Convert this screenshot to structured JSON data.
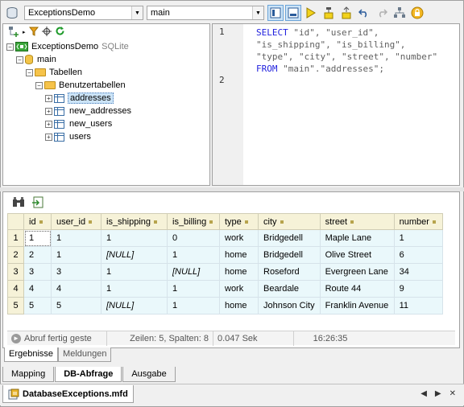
{
  "toolbar": {
    "connection": "ExceptionsDemo",
    "schema": "main"
  },
  "tree": {
    "root": "ExceptionsDemo",
    "root_type": "SQLite",
    "schema": "main",
    "folder": "Tabellen",
    "subfolder": "Benutzertabellen",
    "tables": [
      "addresses",
      "new_addresses",
      "new_users",
      "users"
    ]
  },
  "sql": {
    "line1": "1",
    "line2": "2",
    "kw_select": "SELECT",
    "row1": " \"id\", \"user_id\",",
    "row2": "\"is_shipping\", \"is_billing\",",
    "row3": "\"type\", \"city\", \"street\", \"number\"",
    "kw_from": "FROM",
    "row4_rest": " \"main\".\"addresses\";"
  },
  "results": {
    "columns": [
      "id",
      "user_id",
      "is_shipping",
      "is_billing",
      "type",
      "city",
      "street",
      "number"
    ],
    "rows": [
      {
        "n": "1",
        "c": [
          "1",
          "1",
          "1",
          "0",
          "work",
          "Bridgedell",
          "Maple Lane",
          "1"
        ]
      },
      {
        "n": "2",
        "c": [
          "2",
          "1",
          "[NULL]",
          "1",
          "home",
          "Bridgedell",
          "Olive Street",
          "6"
        ]
      },
      {
        "n": "3",
        "c": [
          "3",
          "3",
          "1",
          "[NULL]",
          "home",
          "Roseford",
          "Evergreen Lane",
          "34"
        ]
      },
      {
        "n": "4",
        "c": [
          "4",
          "4",
          "1",
          "1",
          "work",
          "Beardale",
          "Route 44",
          "9"
        ]
      },
      {
        "n": "5",
        "c": [
          "5",
          "5",
          "[NULL]",
          "1",
          "home",
          "Johnson City",
          "Franklin Avenue",
          "11"
        ]
      }
    ]
  },
  "status": {
    "message": "Abruf fertig geste",
    "rows_cols": "Zeilen: 5, Spalten: 8",
    "duration": "0.047 Sek",
    "time": "16:26:35"
  },
  "result_tabs": [
    "Ergebnisse",
    "Meldungen"
  ],
  "view_tabs": [
    "Mapping",
    "DB-Abfrage",
    "Ausgabe"
  ],
  "document": {
    "name": "DatabaseExceptions.mfd"
  },
  "colors": {
    "header_bg": "#f6f2d8",
    "row_bg": "#eaf8fb",
    "keyword": "#1f1fdd"
  }
}
